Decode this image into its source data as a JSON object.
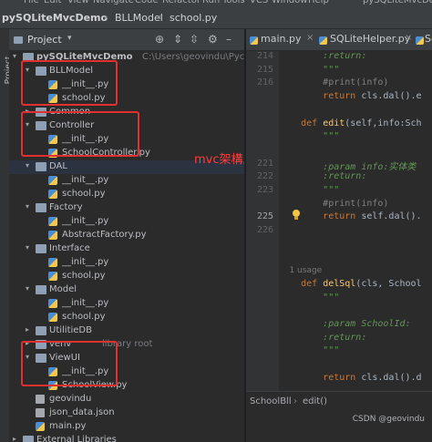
{
  "menu": [
    "File",
    "Edit",
    "View",
    "Navigate",
    "Code",
    "Refactor",
    "Run",
    "Tools",
    "VCS",
    "Window",
    "Help",
    "pySQLiteMvcDemo"
  ],
  "breadcrumb": {
    "project": "pySQLiteMvcDemo",
    "folder": "BLLModel",
    "file": "school.py"
  },
  "side_strip": {
    "label": "Project"
  },
  "project_panel": {
    "title": "Project",
    "header_icons": [
      "target-icon",
      "collapse-icon",
      "expand-icon",
      "gear-icon",
      "minimize-icon"
    ]
  },
  "tree": [
    {
      "level": 0,
      "arrow": "down",
      "icon": "folder",
      "label": "pySQLiteMvcDemo",
      "extra": "C:\\Users\\geovindu\\PycharmPr"
    },
    {
      "level": 1,
      "arrow": "down",
      "icon": "folder",
      "label": "BLLModel"
    },
    {
      "level": 2,
      "arrow": "",
      "icon": "py",
      "label": "__init__.py"
    },
    {
      "level": 2,
      "arrow": "",
      "icon": "py",
      "label": "school.py"
    },
    {
      "level": 1,
      "arrow": "right",
      "icon": "folder",
      "label": "Common"
    },
    {
      "level": 1,
      "arrow": "down",
      "icon": "folder",
      "label": "Controller"
    },
    {
      "level": 2,
      "arrow": "",
      "icon": "py",
      "label": "__init__.py"
    },
    {
      "level": 2,
      "arrow": "",
      "icon": "py",
      "label": "SchoolController.py"
    },
    {
      "level": 1,
      "arrow": "down",
      "icon": "folder",
      "label": "DAL",
      "selected": true
    },
    {
      "level": 2,
      "arrow": "",
      "icon": "py",
      "label": "__init__.py"
    },
    {
      "level": 2,
      "arrow": "",
      "icon": "py",
      "label": "school.py"
    },
    {
      "level": 1,
      "arrow": "down",
      "icon": "folder",
      "label": "Factory"
    },
    {
      "level": 2,
      "arrow": "",
      "icon": "py",
      "label": "__init__.py"
    },
    {
      "level": 2,
      "arrow": "",
      "icon": "py",
      "label": "AbstractFactory.py"
    },
    {
      "level": 1,
      "arrow": "down",
      "icon": "folder",
      "label": "Interface"
    },
    {
      "level": 2,
      "arrow": "",
      "icon": "py",
      "label": "__init__.py"
    },
    {
      "level": 2,
      "arrow": "",
      "icon": "py",
      "label": "school.py"
    },
    {
      "level": 1,
      "arrow": "down",
      "icon": "folder",
      "label": "Model"
    },
    {
      "level": 2,
      "arrow": "",
      "icon": "py",
      "label": "__init__.py"
    },
    {
      "level": 2,
      "arrow": "",
      "icon": "py",
      "label": "school.py"
    },
    {
      "level": 1,
      "arrow": "right",
      "icon": "folder",
      "label": "UtilitieDB"
    },
    {
      "level": 1,
      "arrow": "right",
      "icon": "folder",
      "label": "venv",
      "extra": "library root"
    },
    {
      "level": 1,
      "arrow": "down",
      "icon": "folder",
      "label": "ViewUI"
    },
    {
      "level": 2,
      "arrow": "",
      "icon": "py",
      "label": "__init__.py"
    },
    {
      "level": 2,
      "arrow": "",
      "icon": "py",
      "label": "SchoolView.py"
    },
    {
      "level": 1,
      "arrow": "",
      "icon": "db",
      "label": "geovindu"
    },
    {
      "level": 1,
      "arrow": "",
      "icon": "json",
      "label": "json_data.json"
    },
    {
      "level": 1,
      "arrow": "",
      "icon": "py",
      "label": "main.py"
    },
    {
      "level": 0,
      "arrow": "right",
      "icon": "lib",
      "label": "External Libraries"
    }
  ],
  "annotation": "mvc架構上",
  "editor_tabs": [
    "main.py",
    "SQLiteHelper.py",
    "Sq"
  ],
  "gutter": [
    "214",
    "215",
    "216",
    "",
    "",
    "",
    "",
    "",
    "221",
    "222",
    "223",
    "",
    "225",
    "226",
    "",
    "",
    "",
    "",
    "",
    "",
    "",
    "",
    "",
    "",
    "",
    "",
    ""
  ],
  "code": [
    {
      "parts": [
        {
          "t": "        ",
          "c": "plain"
        },
        {
          "t": ":return:",
          "c": "doc"
        }
      ]
    },
    {
      "parts": [
        {
          "t": "        ",
          "c": "plain"
        },
        {
          "t": "\"\"\"",
          "c": "doc"
        }
      ]
    },
    {
      "parts": [
        {
          "t": "        ",
          "c": "plain"
        },
        {
          "t": "#print(info)",
          "c": "cmt"
        }
      ]
    },
    {
      "parts": [
        {
          "t": "        ",
          "c": "plain"
        },
        {
          "t": "return ",
          "c": "kw"
        },
        {
          "t": "cls.dal().e",
          "c": "plain"
        }
      ]
    },
    {
      "parts": []
    },
    {
      "parts": [
        {
          "t": "    ",
          "c": "plain"
        },
        {
          "t": "def ",
          "c": "kw"
        },
        {
          "t": "edit",
          "c": "fn"
        },
        {
          "t": "(self,info:Sch",
          "c": "plain"
        }
      ]
    },
    {
      "parts": [
        {
          "t": "        ",
          "c": "plain"
        },
        {
          "t": "\"\"\"",
          "c": "doc"
        }
      ]
    },
    {
      "parts": []
    },
    {
      "parts": [
        {
          "t": "        ",
          "c": "plain"
        },
        {
          "t": ":param info:实体类",
          "c": "doc"
        }
      ]
    },
    {
      "parts": [
        {
          "t": "        ",
          "c": "plain"
        },
        {
          "t": ":return:",
          "c": "doc"
        }
      ]
    },
    {
      "parts": [
        {
          "t": "        ",
          "c": "plain"
        },
        {
          "t": "\"\"\"",
          "c": "doc"
        }
      ]
    },
    {
      "parts": [
        {
          "t": "        ",
          "c": "plain"
        },
        {
          "t": "#print(info)",
          "c": "cmt"
        }
      ]
    },
    {
      "parts": [
        {
          "t": "        ",
          "c": "plain"
        },
        {
          "t": "return ",
          "c": "kw"
        },
        {
          "t": "self.dal().",
          "c": "plain"
        }
      ]
    },
    {
      "parts": []
    },
    {
      "parts": []
    },
    {
      "parts": []
    },
    {
      "parts": [
        {
          "t": "    1 usage",
          "c": "hint"
        }
      ]
    },
    {
      "parts": [
        {
          "t": "    ",
          "c": "plain"
        },
        {
          "t": "def ",
          "c": "kw"
        },
        {
          "t": "delSql",
          "c": "fn"
        },
        {
          "t": "(cls, School",
          "c": "plain"
        }
      ]
    },
    {
      "parts": [
        {
          "t": "        ",
          "c": "plain"
        },
        {
          "t": "\"\"\"",
          "c": "doc"
        }
      ]
    },
    {
      "parts": []
    },
    {
      "parts": [
        {
          "t": "        ",
          "c": "plain"
        },
        {
          "t": ":param SchoolId:",
          "c": "doc"
        }
      ]
    },
    {
      "parts": [
        {
          "t": "        ",
          "c": "plain"
        },
        {
          "t": ":return:",
          "c": "doc"
        }
      ]
    },
    {
      "parts": [
        {
          "t": "        ",
          "c": "plain"
        },
        {
          "t": "\"\"\"",
          "c": "doc"
        }
      ]
    },
    {
      "parts": []
    },
    {
      "parts": [
        {
          "t": "        ",
          "c": "plain"
        },
        {
          "t": "return ",
          "c": "kw"
        },
        {
          "t": "cls.dal().d",
          "c": "plain"
        }
      ]
    }
  ],
  "status": {
    "crumb1": "SchoolBll",
    "crumb2": "edit()",
    "watermark": "CSDN @geovindu"
  }
}
